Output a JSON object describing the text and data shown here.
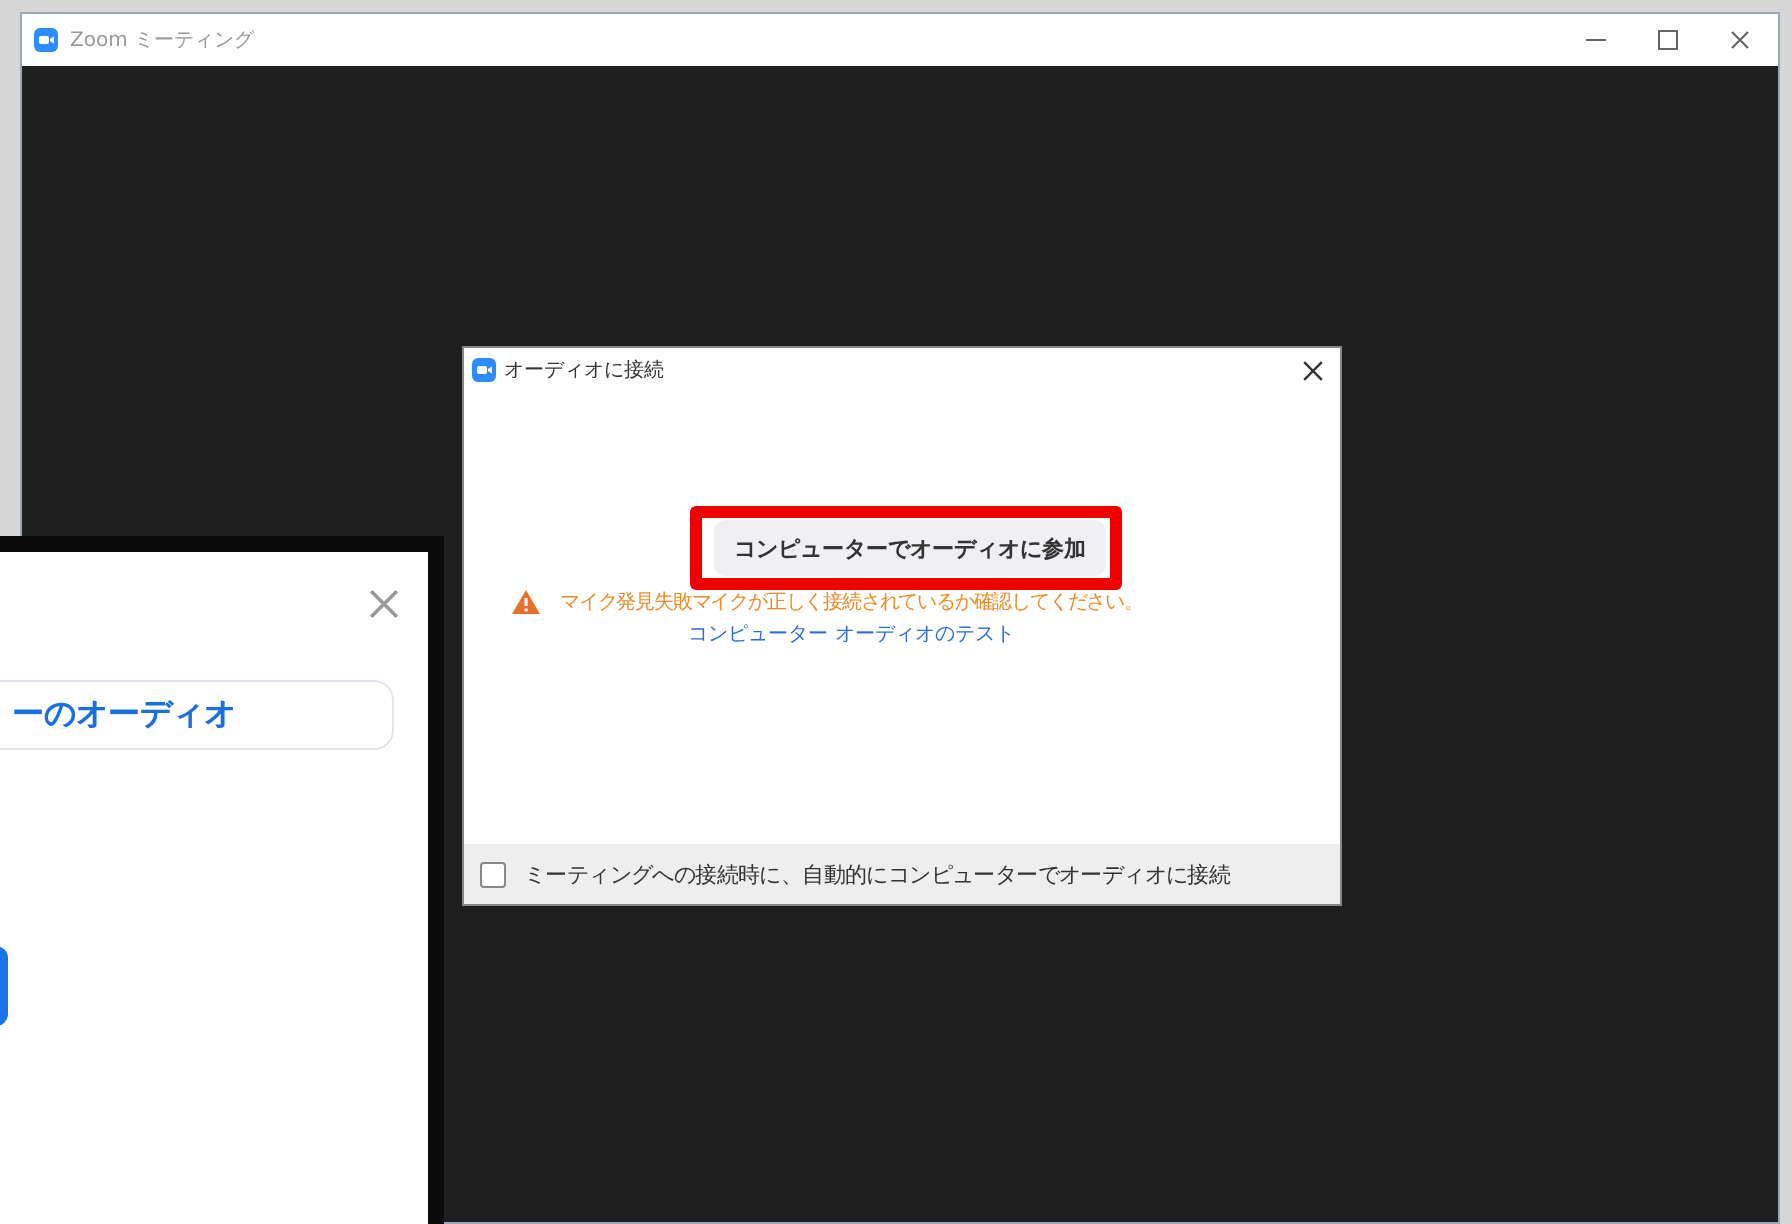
{
  "main_window": {
    "title": "Zoom ミーティング"
  },
  "audio_dialog": {
    "title": "オーディオに接続",
    "join_button": {
      "label": "コンピューターでオーディオに参加",
      "highlighted": true
    },
    "warning": "マイク発見失敗マイクが正しく接続されているか確認してください。",
    "test_link": "コンピューター オーディオのテスト",
    "auto_connect": {
      "label": "ミーティングへの接続時に、自動的にコンピューターでオーディオに接続",
      "checked": false
    }
  },
  "back_dialog": {
    "option_button": "ーのオーディオ"
  }
}
